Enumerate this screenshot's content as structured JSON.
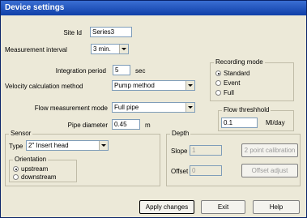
{
  "window": {
    "title": "Device settings"
  },
  "site": {
    "label": "Site Id",
    "value": "Series3"
  },
  "measurement_interval": {
    "label": "Measurement interval",
    "value": "3 min."
  },
  "integration_period": {
    "label": "Integration period",
    "value": "5",
    "unit": "sec"
  },
  "velocity_method": {
    "label": "Velocity calculation method",
    "value": "Pump method"
  },
  "flow_mode": {
    "label": "Flow measurement mode",
    "value": "Full pipe"
  },
  "pipe_diameter": {
    "label": "Pipe diameter",
    "value": "0.45",
    "unit": "m"
  },
  "recording_mode": {
    "caption": "Recording mode",
    "options": [
      {
        "label": "Standard",
        "selected": true
      },
      {
        "label": "Event",
        "selected": false
      },
      {
        "label": "Full",
        "selected": false
      }
    ]
  },
  "flow_threshold": {
    "caption": "Flow threshhold",
    "value": "0.1",
    "unit": "Ml/day"
  },
  "sensor": {
    "caption": "Sensor",
    "type_label": "Type",
    "type_value": "2\" Insert head",
    "orientation": {
      "caption": "Orientation",
      "options": [
        {
          "label": "upstream",
          "selected": true
        },
        {
          "label": "downstream",
          "selected": false
        }
      ]
    }
  },
  "depth": {
    "caption": "Depth",
    "slope_label": "Slope",
    "slope_value": "1",
    "offset_label": "Offset",
    "offset_value": "0",
    "calibration_button": "2 point calibration",
    "offset_adjust_button": "Offset adjust"
  },
  "buttons": {
    "apply": "Apply changes",
    "exit": "Exit",
    "help": "Help"
  }
}
